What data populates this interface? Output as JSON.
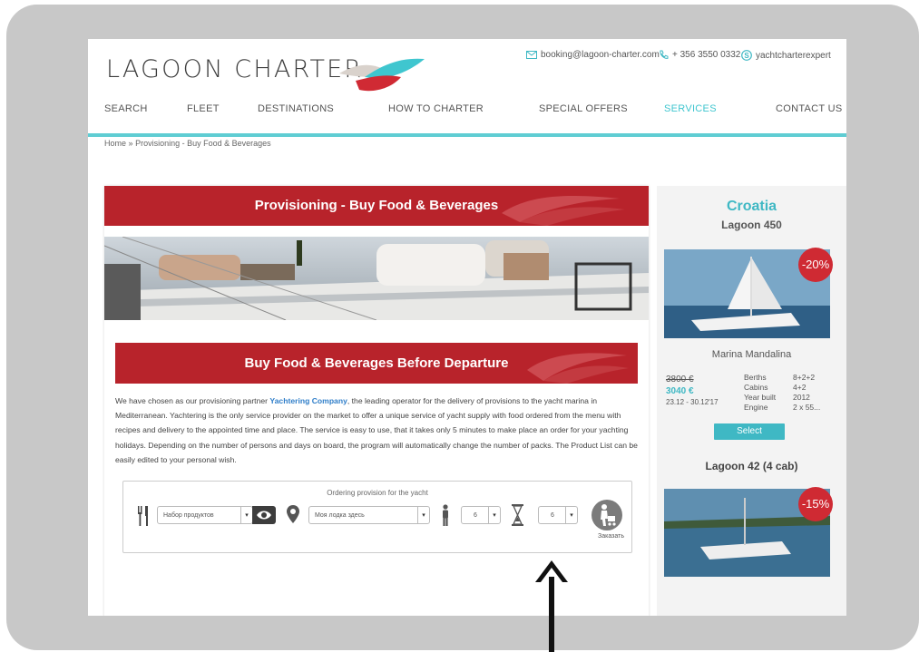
{
  "header": {
    "logo": "LAGOON CHARTER",
    "email": "booking@lagoon-charter.com",
    "phone": "+ 356 3550 0332",
    "skype": "yachtcharterexpert"
  },
  "nav": [
    "SEARCH",
    "FLEET",
    "DESTINATIONS",
    "HOW TO CHARTER",
    "SPECIAL OFFERS",
    "SERVICES",
    "CONTACT US"
  ],
  "breadcrumb": {
    "home": "Home",
    "sep": "»",
    "current": "Provisioning - Buy Food & Beverages"
  },
  "main": {
    "title": "Provisioning - Buy Food & Beverages",
    "subtitle": "Buy Food & Beverages Before Departure",
    "para_before": "We have chosen as our provisioning partner ",
    "para_link": "Yachtering Company",
    "para_after": ", the leading operator for the delivery of provisions to the yacht marina in Mediterranean.  Yachtering is the only service provider on the market to offer a unique service of yacht supply with food ordered from the menu with recipes and delivery to the appointed time and place. The service is easy to use, that it takes only 5 minutes to make place an order for your yachting holidays. Depending on the number of persons and days on board, the program will automatically change the number of packs. The Product List can be easily edited to your personal wish."
  },
  "order_widget": {
    "title": "Ordering provision for the yacht",
    "product_set": "Набор продуктов",
    "boat": "Моя лодка здесь",
    "persons": "6",
    "days": "6",
    "order_label": "Заказать"
  },
  "sidebar": {
    "country": "Croatia",
    "model1": "Lagoon 450",
    "discount1": "-20%",
    "marina": "Marina Mandalina",
    "old_price": "3800 €",
    "new_price": "3040 €",
    "dates": "23.12 - 30.12'17",
    "specs": [
      {
        "label": "Berths",
        "value": "8+2+2"
      },
      {
        "label": "Cabins",
        "value": "4+2"
      },
      {
        "label": "Year built",
        "value": "2012"
      },
      {
        "label": "Engine",
        "value": "2 x 55..."
      }
    ],
    "select_label": "Select",
    "model2": "Lagoon 42 (4 cab)",
    "discount2": "-15%"
  },
  "colors": {
    "accent_teal": "#3fb8c4",
    "banner_red": "#b8232b",
    "frame_gray": "#c8c8c8"
  }
}
